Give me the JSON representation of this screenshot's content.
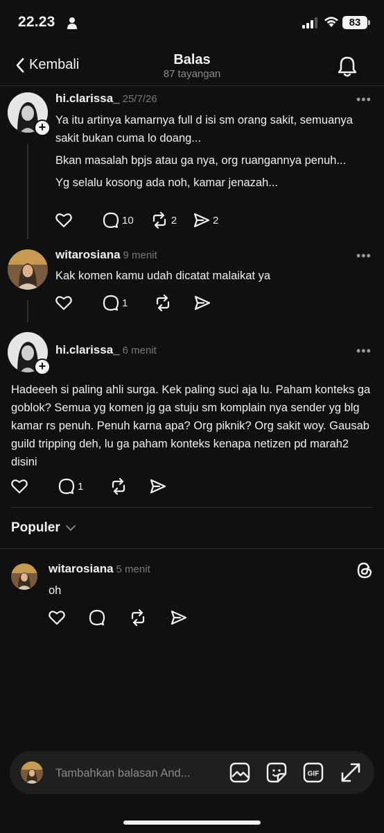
{
  "status_bar": {
    "time": "22.23",
    "battery": "83"
  },
  "header": {
    "back_label": "Kembali",
    "title": "Balas",
    "subtitle": "87 tayangan"
  },
  "posts": [
    {
      "username": "hi.clarissa_",
      "time": "25/7/26",
      "more": "•••",
      "paragraphs": [
        "Ya itu artinya kamarnya full d isi sm orang sakit, semuanya sakit bukan cuma lo doang...",
        "Bkan masalah bpjs atau ga nya, org ruangannya penuh...",
        "Yg selalu kosong ada noh, kamar jenazah..."
      ],
      "counts": {
        "replies": "10",
        "reposts": "2",
        "shares": "2"
      }
    },
    {
      "username": "witarosiana",
      "time": "9 menit",
      "more": "•••",
      "text": "Kak komen kamu udah dicatat malaikat ya",
      "counts": {
        "replies": "1"
      }
    },
    {
      "username": "hi.clarissa_",
      "time": "6 menit",
      "more": "•••",
      "text": "Hadeeeh si paling ahli surga. Kek paling suci aja lu. Paham konteks ga goblok? Semua yg komen jg ga stuju sm komplain nya sender yg blg kamar rs penuh. Penuh karna apa? Org piknik? Org sakit woy. Gausab guild tripping deh, lu ga paham konteks kenapa netizen pd marah2 disini",
      "counts": {
        "replies": "1"
      }
    }
  ],
  "populer": {
    "label": "Populer"
  },
  "reply": {
    "username": "witarosiana",
    "time": "5 menit",
    "text": "oh"
  },
  "reply_bar": {
    "placeholder": "Tambahkan balasan And..."
  },
  "icons": {
    "back": "chevron-left-icon",
    "bell": "bell-icon",
    "like": "heart-icon",
    "comment": "comment-icon",
    "repost": "repost-icon",
    "share": "send-icon",
    "threads": "threads-logo-icon",
    "image": "image-icon",
    "sticker": "sticker-icon",
    "gif": "gif-icon",
    "expand": "expand-icon"
  },
  "colors": {
    "background": "#101010",
    "text": "#f3f3f3",
    "muted": "#777777",
    "divider": "#2a2a2a",
    "reply_bar": "#1f1f1f"
  }
}
